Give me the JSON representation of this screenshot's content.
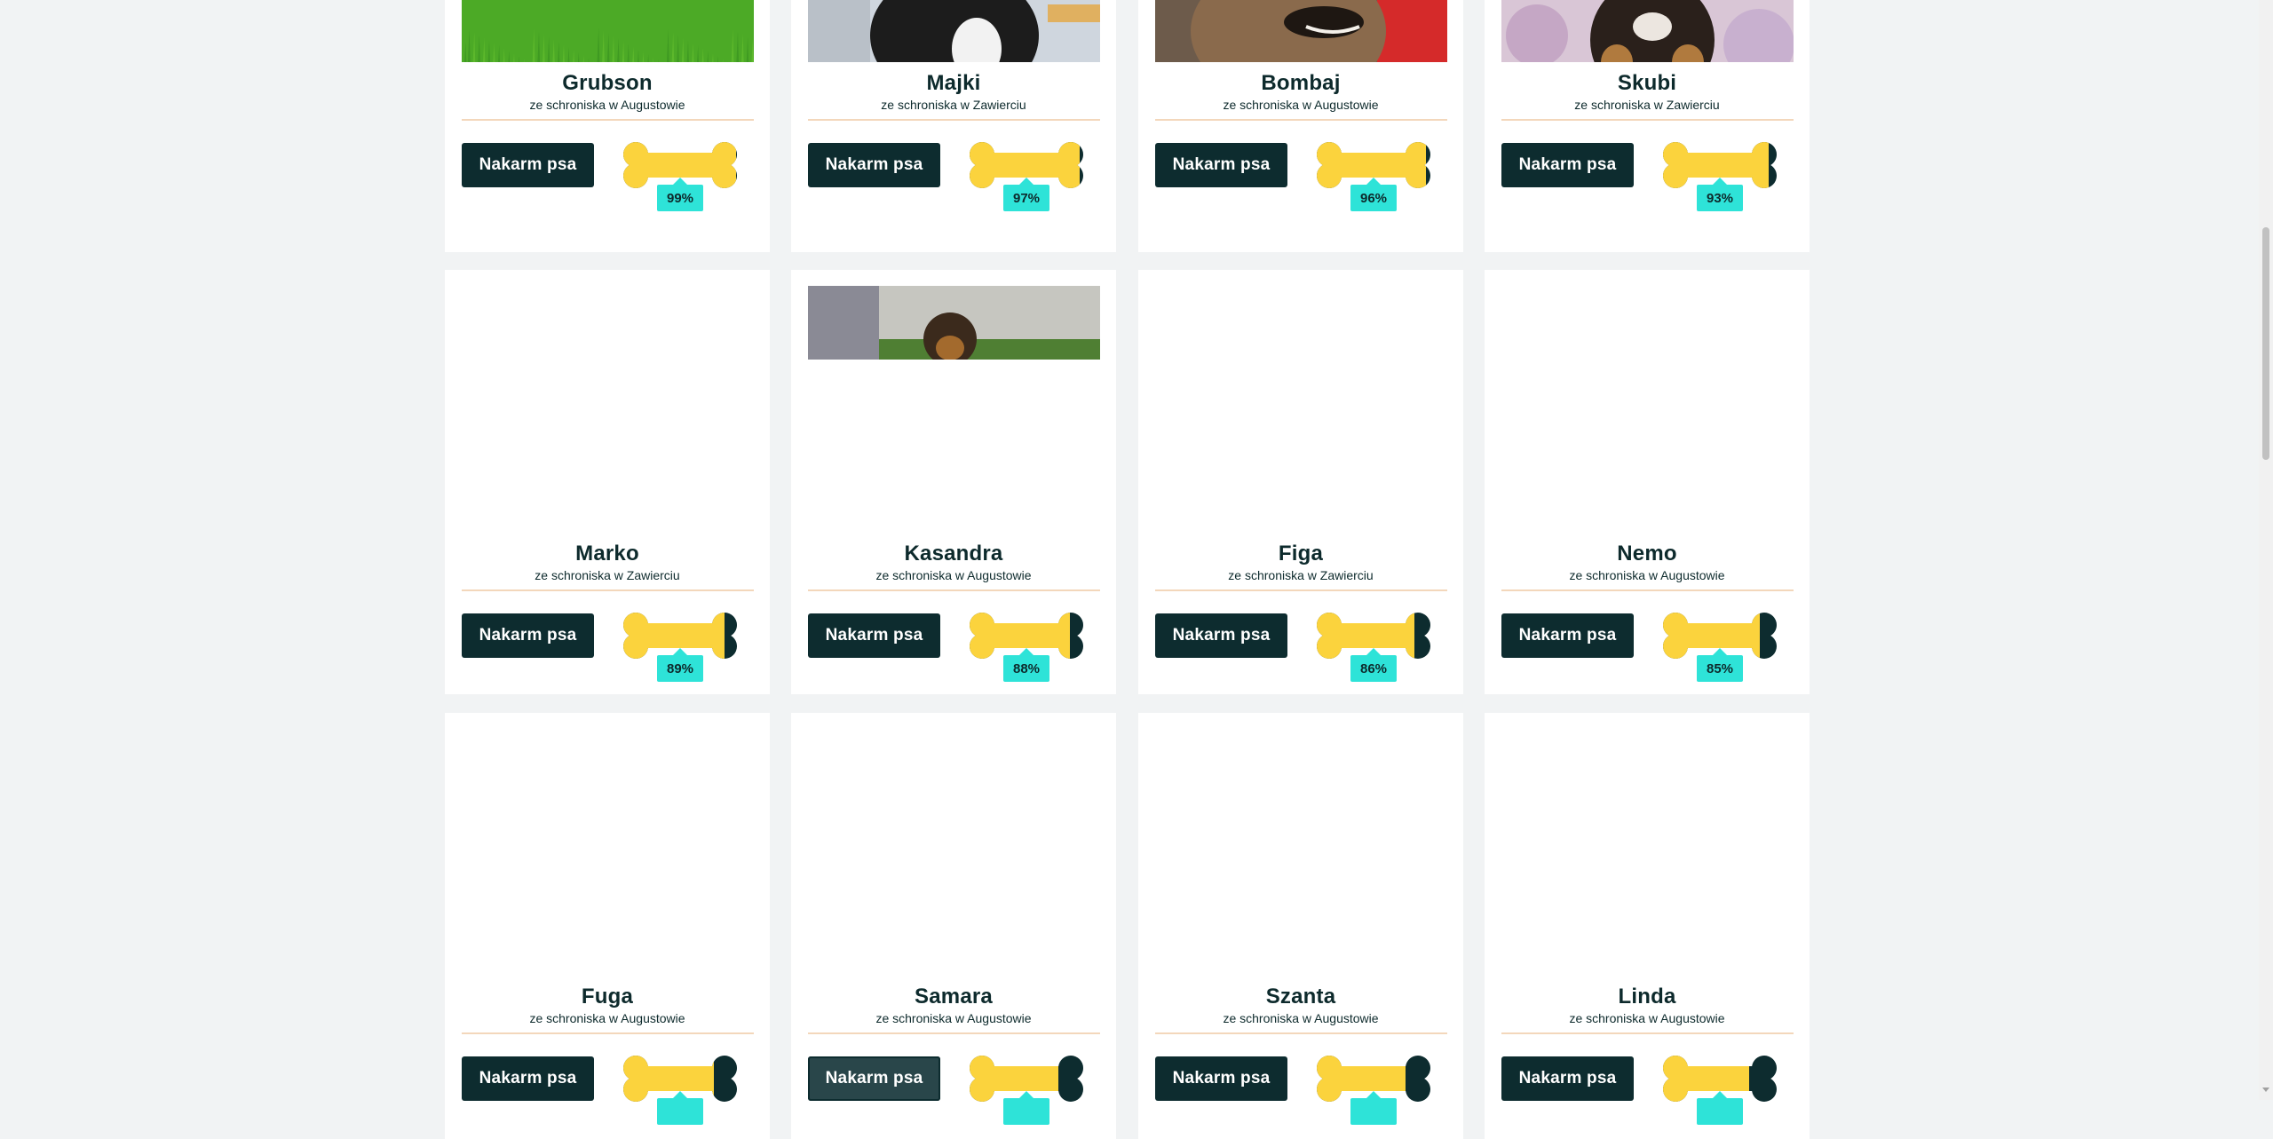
{
  "colors": {
    "background": "#f1f3f4",
    "card": "#ffffff",
    "button": "#0d2c2f",
    "bone_fill": "#fbd33d",
    "bone_empty": "#0d2c2f",
    "percent_badge": "#2ee3d8",
    "divider": "#f3d7bb"
  },
  "dogs": [
    {
      "name": "Grubson",
      "shelter": "ze schroniska w Augustowie",
      "button": "Nakarm psa",
      "fed_percent": "99%",
      "fed_value": 99,
      "photo": "dog-photo-grass"
    },
    {
      "name": "Majki",
      "shelter": "ze schroniska w Zawierciu",
      "button": "Nakarm psa",
      "fed_percent": "97%",
      "fed_value": 97,
      "photo": "dog-photo-black-white"
    },
    {
      "name": "Bombaj",
      "shelter": "ze schroniska w Augustowie",
      "button": "Nakarm psa",
      "fed_percent": "96%",
      "fed_value": 96,
      "photo": "dog-photo-brindle"
    },
    {
      "name": "Skubi",
      "shelter": "ze schroniska w Zawierciu",
      "button": "Nakarm psa",
      "fed_percent": "93%",
      "fed_value": 93,
      "photo": "dog-photo-tricolor"
    },
    {
      "name": "Marko",
      "shelter": "ze schroniska w Zawierciu",
      "button": "Nakarm psa",
      "fed_percent": "89%",
      "fed_value": 89,
      "photo": ""
    },
    {
      "name": "Kasandra",
      "shelter": "ze schroniska w Augustowie",
      "button": "Nakarm psa",
      "fed_percent": "88%",
      "fed_value": 88,
      "photo": "dog-photo-loading"
    },
    {
      "name": "Figa",
      "shelter": "ze schroniska w Zawierciu",
      "button": "Nakarm psa",
      "fed_percent": "86%",
      "fed_value": 86,
      "photo": ""
    },
    {
      "name": "Nemo",
      "shelter": "ze schroniska w Augustowie",
      "button": "Nakarm psa",
      "fed_percent": "85%",
      "fed_value": 85,
      "photo": ""
    },
    {
      "name": "Fuga",
      "shelter": "ze schroniska w Augustowie",
      "button": "Nakarm psa",
      "fed_percent": "",
      "fed_value": 80,
      "photo": ""
    },
    {
      "name": "Samara",
      "shelter": "ze schroniska w Augustowie",
      "button": "Nakarm psa",
      "fed_percent": "",
      "fed_value": 78,
      "photo": ""
    },
    {
      "name": "Szanta",
      "shelter": "ze schroniska w Augustowie",
      "button": "Nakarm psa",
      "fed_percent": "",
      "fed_value": 78,
      "photo": ""
    },
    {
      "name": "Linda",
      "shelter": "ze schroniska w Augustowie",
      "button": "Nakarm psa",
      "fed_percent": "",
      "fed_value": 76,
      "photo": ""
    }
  ]
}
